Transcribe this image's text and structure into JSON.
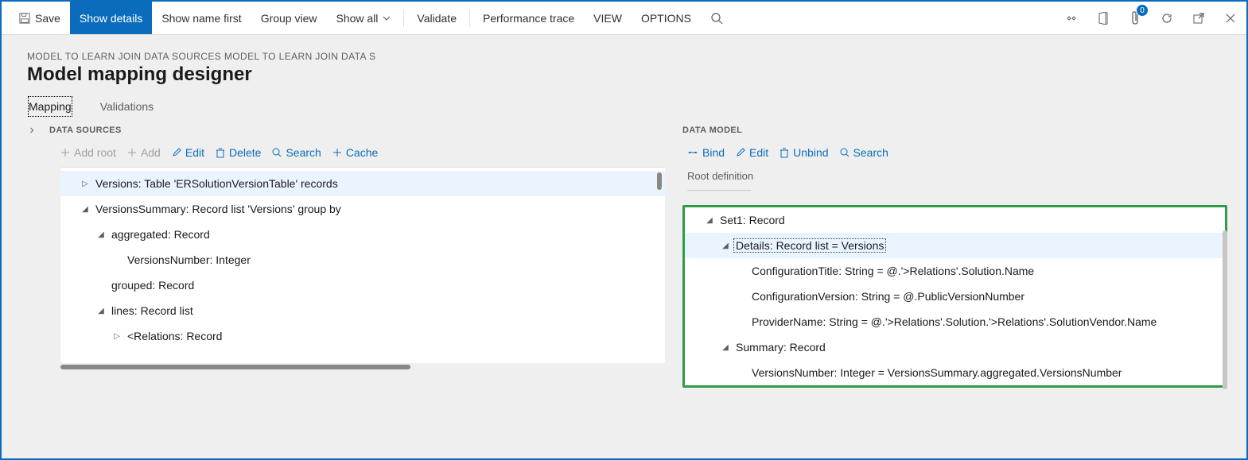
{
  "toolbar": {
    "save": "Save",
    "show_details": "Show details",
    "show_name_first": "Show name first",
    "group_view": "Group view",
    "show_all": "Show all",
    "validate": "Validate",
    "perf_trace": "Performance trace",
    "view": "VIEW",
    "options": "OPTIONS",
    "attach_count": "0"
  },
  "header": {
    "breadcrumb": "MODEL TO LEARN JOIN DATA SOURCES MODEL TO LEARN JOIN DATA S",
    "title": "Model mapping designer"
  },
  "tabs": {
    "mapping": "Mapping",
    "validations": "Validations"
  },
  "data_sources": {
    "title": "DATA SOURCES",
    "add_root": "Add root",
    "add": "Add",
    "edit": "Edit",
    "delete": "Delete",
    "search": "Search",
    "cache": "Cache",
    "tree": {
      "n0": "Versions: Table 'ERSolutionVersionTable' records",
      "n1": "VersionsSummary: Record list 'Versions' group by",
      "n2": "aggregated: Record",
      "n3": "VersionsNumber: Integer",
      "n4": "grouped: Record",
      "n5": "lines: Record list",
      "n6": "<Relations: Record"
    }
  },
  "data_model": {
    "title": "DATA MODEL",
    "bind": "Bind",
    "edit": "Edit",
    "unbind": "Unbind",
    "search": "Search",
    "root_def": "Root definition",
    "tree": {
      "n0": "Set1: Record",
      "n1": "Details: Record list = Versions",
      "n2": "ConfigurationTitle: String = @.'>Relations'.Solution.Name",
      "n3": "ConfigurationVersion: String = @.PublicVersionNumber",
      "n4": "ProviderName: String = @.'>Relations'.Solution.'>Relations'.SolutionVendor.Name",
      "n5": "Summary: Record",
      "n6": "VersionsNumber: Integer = VersionsSummary.aggregated.VersionsNumber"
    }
  }
}
